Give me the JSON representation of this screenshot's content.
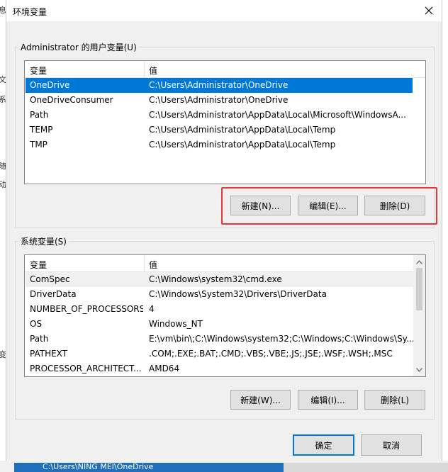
{
  "background": {
    "left_fragments": [
      "息",
      "文",
      "系",
      "随",
      "动",
      "变"
    ],
    "taskbar_text": "C:\\Users\\NING MEI\\OneDrive"
  },
  "dialog": {
    "title": "环境变量",
    "close_icon": "close-icon"
  },
  "user_vars": {
    "group_label": "Administrator 的用户变量(U)",
    "col_name": "变量",
    "col_value": "值",
    "rows": [
      {
        "name": "OneDrive",
        "value": "C:\\Users\\Administrator\\OneDrive"
      },
      {
        "name": "OneDriveConsumer",
        "value": "C:\\Users\\Administrator\\OneDrive"
      },
      {
        "name": "Path",
        "value": "C:\\Users\\Administrator\\AppData\\Local\\Microsoft\\WindowsA..."
      },
      {
        "name": "TEMP",
        "value": "C:\\Users\\Administrator\\AppData\\Local\\Temp"
      },
      {
        "name": "TMP",
        "value": "C:\\Users\\Administrator\\AppData\\Local\\Temp"
      }
    ],
    "new_label": "新建(N)...",
    "edit_label": "编辑(E)...",
    "delete_label": "删除(D)"
  },
  "system_vars": {
    "group_label": "系统变量(S)",
    "col_name": "变量",
    "col_value": "值",
    "rows": [
      {
        "name": "ComSpec",
        "value": "C:\\Windows\\system32\\cmd.exe"
      },
      {
        "name": "DriverData",
        "value": "C:\\Windows\\System32\\Drivers\\DriverData"
      },
      {
        "name": "NUMBER_OF_PROCESSORS",
        "value": "4"
      },
      {
        "name": "OS",
        "value": "Windows_NT"
      },
      {
        "name": "Path",
        "value": "E:\\vm\\bin\\;C:\\Windows\\system32;C:\\Windows;C:\\Windows\\Sy..."
      },
      {
        "name": "PATHEXT",
        "value": ".COM;.EXE;.BAT;.CMD;.VBS;.VBE;.JS;.JSE;.WSF;.WSH;.MSC"
      },
      {
        "name": "PROCESSOR_ARCHITECT...",
        "value": "AMD64"
      }
    ],
    "new_label": "新建(W)...",
    "edit_label": "编辑(I)...",
    "delete_label": "删除(L)"
  },
  "footer": {
    "ok_label": "确定",
    "cancel_label": "取消"
  },
  "colors": {
    "selection": "#0078d7",
    "highlight_box": "#e53935"
  }
}
